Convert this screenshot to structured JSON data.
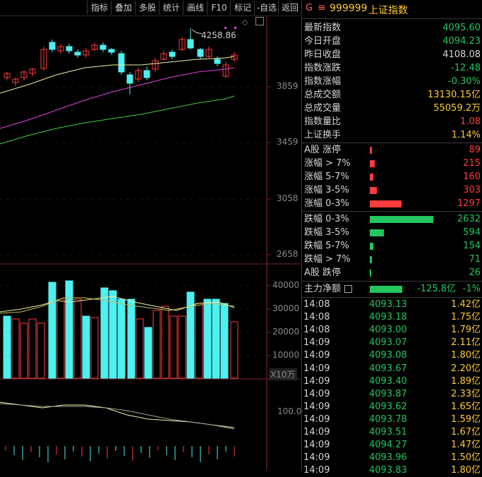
{
  "toolbar": {
    "items": [
      "指标",
      "叠加",
      "多股",
      "统计",
      "画线",
      "F10",
      "标记",
      "-自选",
      "返回"
    ]
  },
  "chart": {
    "price_axis": [
      "3859",
      "3459",
      "3058",
      "2658"
    ],
    "high_annotation": "4258.86",
    "volume_axis": [
      "40000",
      "30000",
      "20000",
      "10000"
    ],
    "volume_unit": "X10万",
    "indicator_axis": "100.0"
  },
  "header": {
    "badge": "G",
    "menu_icon": "≡",
    "code": "999999",
    "name": "上证指数"
  },
  "stats": [
    {
      "label": "最新指数",
      "value": "4095.60",
      "color": "green"
    },
    {
      "label": "今日开盘",
      "value": "4094.23",
      "color": "green"
    },
    {
      "label": "昨日收盘",
      "value": "4108.08",
      "color": "white"
    },
    {
      "label": "指数涨跌",
      "value": "-12.48",
      "color": "green"
    },
    {
      "label": "指数涨幅",
      "value": "-0.30%",
      "color": "green"
    },
    {
      "label": "总成交额",
      "value": "13130.15亿",
      "color": "yellow"
    },
    {
      "label": "总成交量",
      "value": "55059.2万",
      "color": "yellow"
    },
    {
      "label": "指数量比",
      "value": "1.08",
      "color": "red"
    },
    {
      "label": "上证换手",
      "value": "1.14%",
      "color": "yellow"
    }
  ],
  "breadth": [
    {
      "label": "A股 涨停",
      "value": "89",
      "fraction": 0.016,
      "color": "red"
    },
    {
      "label": "涨幅 > 7%",
      "value": "215",
      "fraction": 0.041,
      "color": "red"
    },
    {
      "label": "涨幅 5-7%",
      "value": "160",
      "fraction": 0.03,
      "color": "red"
    },
    {
      "label": "涨幅 3-5%",
      "value": "303",
      "fraction": 0.058,
      "color": "red"
    },
    {
      "label": "涨幅 0-3%",
      "value": "1297",
      "fraction": 0.248,
      "color": "red"
    },
    {
      "label": "跌幅 0-3%",
      "value": "2632",
      "fraction": 0.5,
      "color": "green"
    },
    {
      "label": "跌幅 3-5%",
      "value": "594",
      "fraction": 0.113,
      "color": "green"
    },
    {
      "label": "跌幅 5-7%",
      "value": "154",
      "fraction": 0.03,
      "color": "green"
    },
    {
      "label": "跌幅 > 7%",
      "value": "71",
      "fraction": 0.014,
      "color": "green"
    },
    {
      "label": "A股 跌停",
      "value": "26",
      "fraction": 0.005,
      "color": "green"
    }
  ],
  "main_flow": {
    "label": "主力净额",
    "amount": "-125.8亿",
    "pct": "-1%"
  },
  "ticks": [
    {
      "time": "14:08",
      "price": "4093.13",
      "vol": "1.42亿"
    },
    {
      "time": "14:08",
      "price": "4093.18",
      "vol": "1.75亿"
    },
    {
      "time": "14:08",
      "price": "4093.00",
      "vol": "1.79亿"
    },
    {
      "time": "14:09",
      "price": "4093.07",
      "vol": "2.11亿"
    },
    {
      "time": "14:09",
      "price": "4093.08",
      "vol": "1.80亿"
    },
    {
      "time": "14:09",
      "price": "4093.67",
      "vol": "2.20亿"
    },
    {
      "time": "14:09",
      "price": "4093.40",
      "vol": "1.89亿"
    },
    {
      "time": "14:09",
      "price": "4093.87",
      "vol": "2.33亿"
    },
    {
      "time": "14:09",
      "price": "4093.62",
      "vol": "1.65亿"
    },
    {
      "time": "14:09",
      "price": "4093.78",
      "vol": "1.59亿"
    },
    {
      "time": "14:09",
      "price": "4093.51",
      "vol": "1.67亿"
    },
    {
      "time": "14:09",
      "price": "4094.27",
      "vol": "1.47亿"
    },
    {
      "time": "14:09",
      "price": "4093.96",
      "vol": "1.50亿"
    },
    {
      "time": "14:09",
      "price": "4093.83",
      "vol": "1.80亿"
    }
  ],
  "colors": {
    "up": "#ff3b3b",
    "down": "#4ef0f0",
    "green": "#22c55e",
    "yellow": "#ffcc33",
    "ma5": "#f0f0a0",
    "ma10": "#e040e0",
    "ma20": "#40d040"
  },
  "chart_data": {
    "type": "candlestick",
    "price_axis_ticks": [
      3859,
      3459,
      3058,
      2658
    ],
    "annotated_high": 4258.86,
    "volume_axis_ticks": [
      40000,
      30000,
      20000,
      10000
    ]
  }
}
